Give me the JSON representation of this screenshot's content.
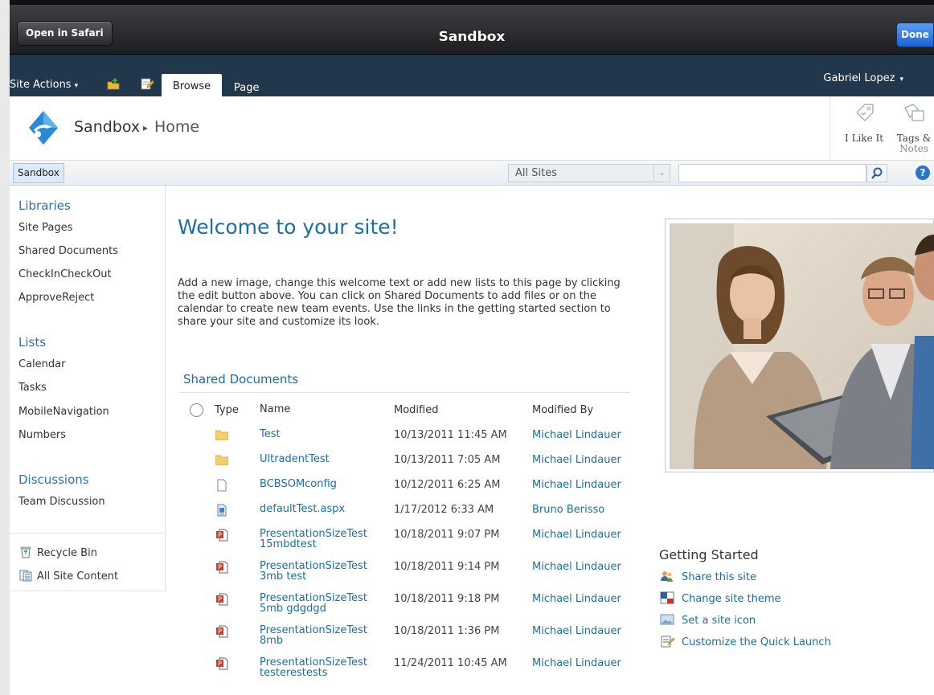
{
  "ios": {
    "open_in_safari": "Open in Safari",
    "title": "Sandbox",
    "done": "Done"
  },
  "ribbon": {
    "site_actions": "Site Actions",
    "tabs": [
      "Browse",
      "Page"
    ],
    "user": "Gabriel Lopez"
  },
  "title_area": {
    "site": "Sandbox",
    "page": "Home",
    "social": [
      "I Like It",
      "Tags &",
      "Notes"
    ]
  },
  "topnav": {
    "sandbox": "Sandbox",
    "scope": "All Sites",
    "search_placeholder": "",
    "help": "?"
  },
  "quicklaunch": {
    "libraries_heading": "Libraries",
    "libraries": [
      "Site Pages",
      "Shared Documents",
      "CheckInCheckOut",
      "ApproveReject"
    ],
    "lists_heading": "Lists",
    "lists": [
      "Calendar",
      "Tasks",
      "MobileNavigation",
      "Numbers"
    ],
    "discussions_heading": "Discussions",
    "discussions": [
      "Team Discussion"
    ],
    "recycle_bin": "Recycle Bin",
    "all_site_content": "All Site Content"
  },
  "main": {
    "welcome": "Welcome to your site!",
    "welcome_text": "Add a new image, change this welcome text or add new lists to this page by clicking the edit button above. You can click on Shared Documents to add files or on the calendar to create new team events. Use the links in the getting started section to share your site and customize its look.",
    "shared_docs_title": "Shared Documents",
    "columns": [
      "Type",
      "Name",
      "Modified",
      "Modified By"
    ],
    "rows": [
      {
        "type": "folder-icon",
        "name": "Test",
        "name2": "",
        "modified": "10/13/2011 11:45 AM",
        "by": "Michael Lindauer"
      },
      {
        "type": "folder-icon",
        "name": "UltradentTest",
        "name2": "",
        "modified": "10/13/2011 7:05 AM",
        "by": "Michael Lindauer"
      },
      {
        "type": "blank-file-icon",
        "name": "BCBSOMconfig",
        "name2": "",
        "modified": "10/12/2011 6:25 AM",
        "by": "Michael Lindauer"
      },
      {
        "type": "aspx-file-icon",
        "name": "defaultTest.aspx",
        "name2": "",
        "modified": "1/17/2012 6:33 AM",
        "by": "Bruno Berisso"
      },
      {
        "type": "powerpoint-file-icon",
        "name": "PresentationSizeTest",
        "name2": "15mbdtest",
        "modified": "10/18/2011 9:07 PM",
        "by": "Michael Lindauer"
      },
      {
        "type": "powerpoint-file-icon",
        "name": "PresentationSizeTest",
        "name2": "3mb test",
        "modified": "10/18/2011 9:14 PM",
        "by": "Michael Lindauer"
      },
      {
        "type": "powerpoint-file-icon",
        "name": "PresentationSizeTest",
        "name2": "5mb gdgdgd",
        "modified": "10/18/2011 9:18 PM",
        "by": "Michael Lindauer"
      },
      {
        "type": "powerpoint-file-icon",
        "name": "PresentationSizeTest",
        "name2": "8mb",
        "modified": "10/18/2011 1:36 PM",
        "by": "Michael Lindauer"
      },
      {
        "type": "powerpoint-file-icon",
        "name": "PresentationSizeTest",
        "name2": "testerestests",
        "modified": "11/24/2011 10:45 AM",
        "by": "Michael Lindauer"
      }
    ]
  },
  "getting_started": {
    "title": "Getting Started",
    "links": [
      "Share this site",
      "Change site theme",
      "Set a site icon",
      "Customize the Quick Launch"
    ]
  },
  "colors": {
    "ribbon_bg": "#21374c",
    "link": "#1c6ea4",
    "ios_done": "#1c62d8"
  }
}
